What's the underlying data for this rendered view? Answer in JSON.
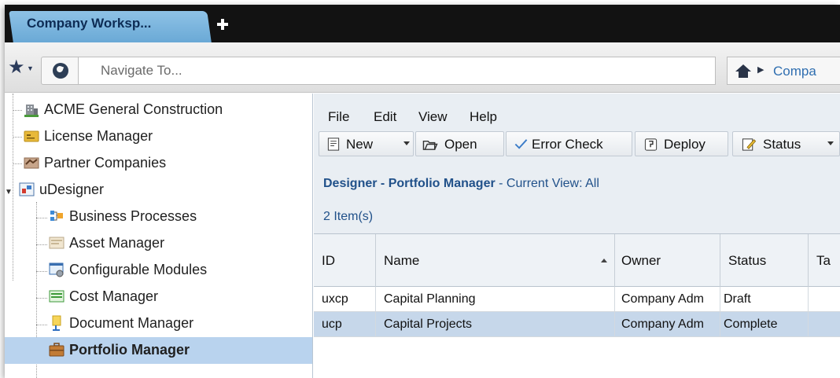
{
  "tabbar": {
    "active_tab": "Company Worksp..."
  },
  "navbar": {
    "placeholder": "Navigate To...",
    "breadcrumb": "Compa"
  },
  "sidebar": {
    "items": [
      {
        "label": "ACME General Construction",
        "icon": "building-icon"
      },
      {
        "label": "License Manager",
        "icon": "license-icon"
      },
      {
        "label": "Partner Companies",
        "icon": "handshake-icon"
      },
      {
        "label": "uDesigner",
        "icon": "designer-icon"
      },
      {
        "label": "Business Processes",
        "icon": "process-icon"
      },
      {
        "label": "Asset Manager",
        "icon": "asset-icon"
      },
      {
        "label": "Configurable Modules",
        "icon": "module-icon"
      },
      {
        "label": "Cost Manager",
        "icon": "cost-icon"
      },
      {
        "label": "Document Manager",
        "icon": "document-icon"
      },
      {
        "label": "Portfolio Manager",
        "icon": "briefcase-icon",
        "selected": true
      }
    ]
  },
  "menubar": [
    "File",
    "Edit",
    "View",
    "Help"
  ],
  "toolbar": {
    "new": "New",
    "open": "Open",
    "error_check": "Error Check",
    "deploy": "Deploy",
    "status": "Status"
  },
  "view": {
    "title": "Designer - Portfolio Manager",
    "subtitle": " - Current View:  All",
    "count": "2  Item(s)"
  },
  "grid": {
    "columns": [
      "ID",
      "Name",
      "Owner",
      "Status",
      "Ta"
    ],
    "rows": [
      {
        "id": "uxcp",
        "name": "Capital Planning",
        "owner": "Company Adm",
        "status": "Draft",
        "ta": ""
      },
      {
        "id": "ucp",
        "name": "Capital Projects",
        "owner": "Company Adm",
        "status": "Complete",
        "ta": "",
        "selected": true
      }
    ]
  },
  "colors": {
    "accent": "#21518a",
    "selection": "#b9d3ee",
    "tab": "#7db7e0",
    "tabbar": "#121212"
  }
}
